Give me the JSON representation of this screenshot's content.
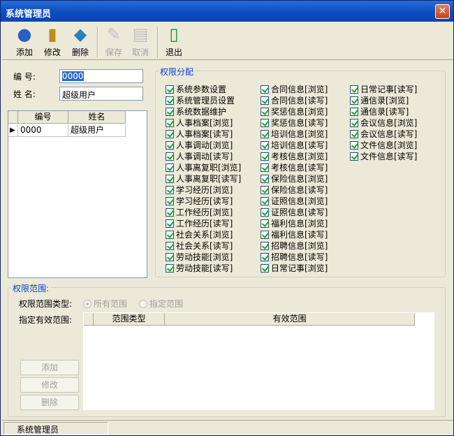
{
  "window": {
    "title": "系统管理员",
    "close_glyph": "✕"
  },
  "toolbar": {
    "add": "添加",
    "edit": "修改",
    "delete": "删除",
    "save": "保存",
    "cancel": "取消",
    "exit": "退出"
  },
  "form": {
    "id_label": "编   号:",
    "id_value": "0000",
    "name_label": "姓   名:",
    "name_value": "超级用户"
  },
  "user_table": {
    "columns": [
      "编号",
      "姓名"
    ],
    "rows": [
      {
        "id": "0000",
        "name": "超级用户"
      }
    ]
  },
  "permissions": {
    "title": "权限分配",
    "col1": [
      "系统参数设置",
      "系统管理员设置",
      "系统数据维护",
      "人事档案[浏览]",
      "人事档案[读写]",
      "人事调动[浏览]",
      "人事调动[读写]",
      "人事离复职[浏览]",
      "人事离复职[读写]",
      "学习经历[浏览]",
      "学习经历[读写]",
      "工作经历[浏览]",
      "工作经历[读写]",
      "社会关系[浏览]",
      "社会关系[读写]",
      "劳动技能[浏览]",
      "劳动技能[读写]"
    ],
    "col2": [
      "合同信息[浏览]",
      "合同信息[读写]",
      "奖惩信息[浏览]",
      "奖惩信息[读写]",
      "培训信息[浏览]",
      "培训信息[读写]",
      "考核信息[浏览]",
      "考核信息[读写]",
      "保险信息[浏览]",
      "保险信息[读写]",
      "证照信息[浏览]",
      "证照信息[读写]",
      "福利信息[浏览]",
      "福利信息[读写]",
      "招聘信息[浏览]",
      "招聘信息[读写]",
      "日常记事[浏览]"
    ],
    "col3": [
      "日常记事[读写]",
      "通信录[浏览]",
      "通信录[读写]",
      "会议信息[浏览]",
      "会议信息[读写]",
      "文件信息[浏览]",
      "文件信息[读写]"
    ]
  },
  "scope": {
    "title": "权限范围:",
    "type_label": "权限范围类型:",
    "radio_all": "所有范围",
    "radio_specific": "指定范围",
    "valid_label": "指定有效范围:",
    "columns": [
      "范围类型",
      "有效范围"
    ],
    "add": "添加",
    "edit": "修改",
    "delete": "删除"
  },
  "status": {
    "text": "系统管理员"
  },
  "colors": {
    "title_bar": "#0a4cc0",
    "accent": "#0046d5",
    "check": "#21a121"
  }
}
